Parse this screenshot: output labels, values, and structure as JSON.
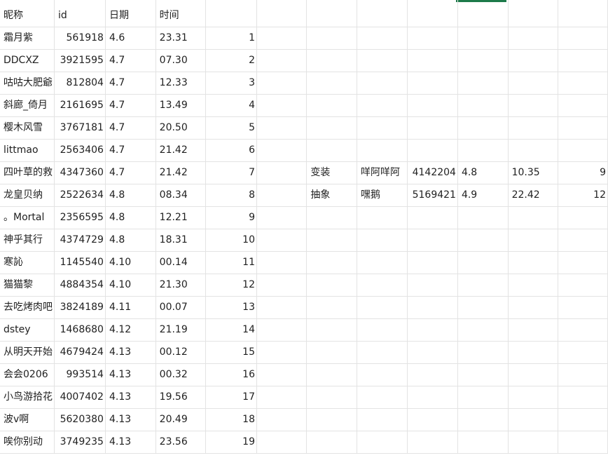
{
  "sheet": {
    "header": {
      "nickname": "昵称",
      "id": "id",
      "date": "日期",
      "time": "时间"
    },
    "rows": [
      {
        "nickname": "霜月紫",
        "id": "561918",
        "date": "4.6",
        "time": "23.31",
        "seq": "1"
      },
      {
        "nickname": "DDCXZ",
        "id": "3921595",
        "date": "4.7",
        "time": "07.30",
        "seq": "2"
      },
      {
        "nickname": "咕咕大肥爺",
        "id": "812804",
        "date": "4.7",
        "time": "12.33",
        "seq": "3"
      },
      {
        "nickname": "斜廊_倚月",
        "id": "2161695",
        "date": "4.7",
        "time": "13.49",
        "seq": "4"
      },
      {
        "nickname": "樱木风雪",
        "id": "3767181",
        "date": "4.7",
        "time": "20.50",
        "seq": "5"
      },
      {
        "nickname": "littmao",
        "id": "2563406",
        "date": "4.7",
        "time": "21.42",
        "seq": "6"
      },
      {
        "nickname": "四叶草的救",
        "id": "4347360",
        "date": "4.7",
        "time": "21.42",
        "seq": "7",
        "extra": {
          "type": "变装",
          "name": "咩阿咩阿",
          "id": "4142204",
          "date": "4.8",
          "time": "10.35",
          "seq": "9"
        }
      },
      {
        "nickname": "龙皇贝纳",
        "id": "2522634",
        "date": "4.8",
        "time": "08.34",
        "seq": "8",
        "extra": {
          "type": "抽象",
          "name": "嘿鹅",
          "id": "5169421",
          "date": "4.9",
          "time": "22.42",
          "seq": "12"
        }
      },
      {
        "nickname": "。Mortal",
        "id": "2356595",
        "date": "4.8",
        "time": "12.21",
        "seq": "9"
      },
      {
        "nickname": "神乎其行",
        "id": "4374729",
        "date": "4.8",
        "time": "18.31",
        "seq": "10"
      },
      {
        "nickname": "寒訫",
        "id": "1145540",
        "date": "4.10",
        "time": "00.14",
        "seq": "11"
      },
      {
        "nickname": "猫猫黎",
        "id": "4884354",
        "date": "4.10",
        "time": "21.30",
        "seq": "12"
      },
      {
        "nickname": "去吃烤肉吧",
        "id": "3824189",
        "date": "4.11",
        "time": "00.07",
        "seq": "13"
      },
      {
        "nickname": "dstey",
        "id": "1468680",
        "date": "4.12",
        "time": "21.19",
        "seq": "14"
      },
      {
        "nickname": "从明天开始",
        "id": "4679424",
        "date": "4.13",
        "time": "00.12",
        "seq": "15"
      },
      {
        "nickname": "会会0206",
        "id": "993514",
        "date": "4.13",
        "time": "00.32",
        "seq": "16"
      },
      {
        "nickname": "小鸟游拾花",
        "id": "4007402",
        "date": "4.13",
        "time": "19.56",
        "seq": "17"
      },
      {
        "nickname": "波v啊",
        "id": "5620380",
        "date": "4.13",
        "time": "20.49",
        "seq": "18"
      },
      {
        "nickname": "唉你别动",
        "id": "3749235",
        "date": "4.13",
        "time": "23.56",
        "seq": "19"
      }
    ]
  },
  "colors": {
    "gridline": "#e3e3e3",
    "active_column_accent": "#1d7a4a",
    "text": "#1f1f1f"
  }
}
